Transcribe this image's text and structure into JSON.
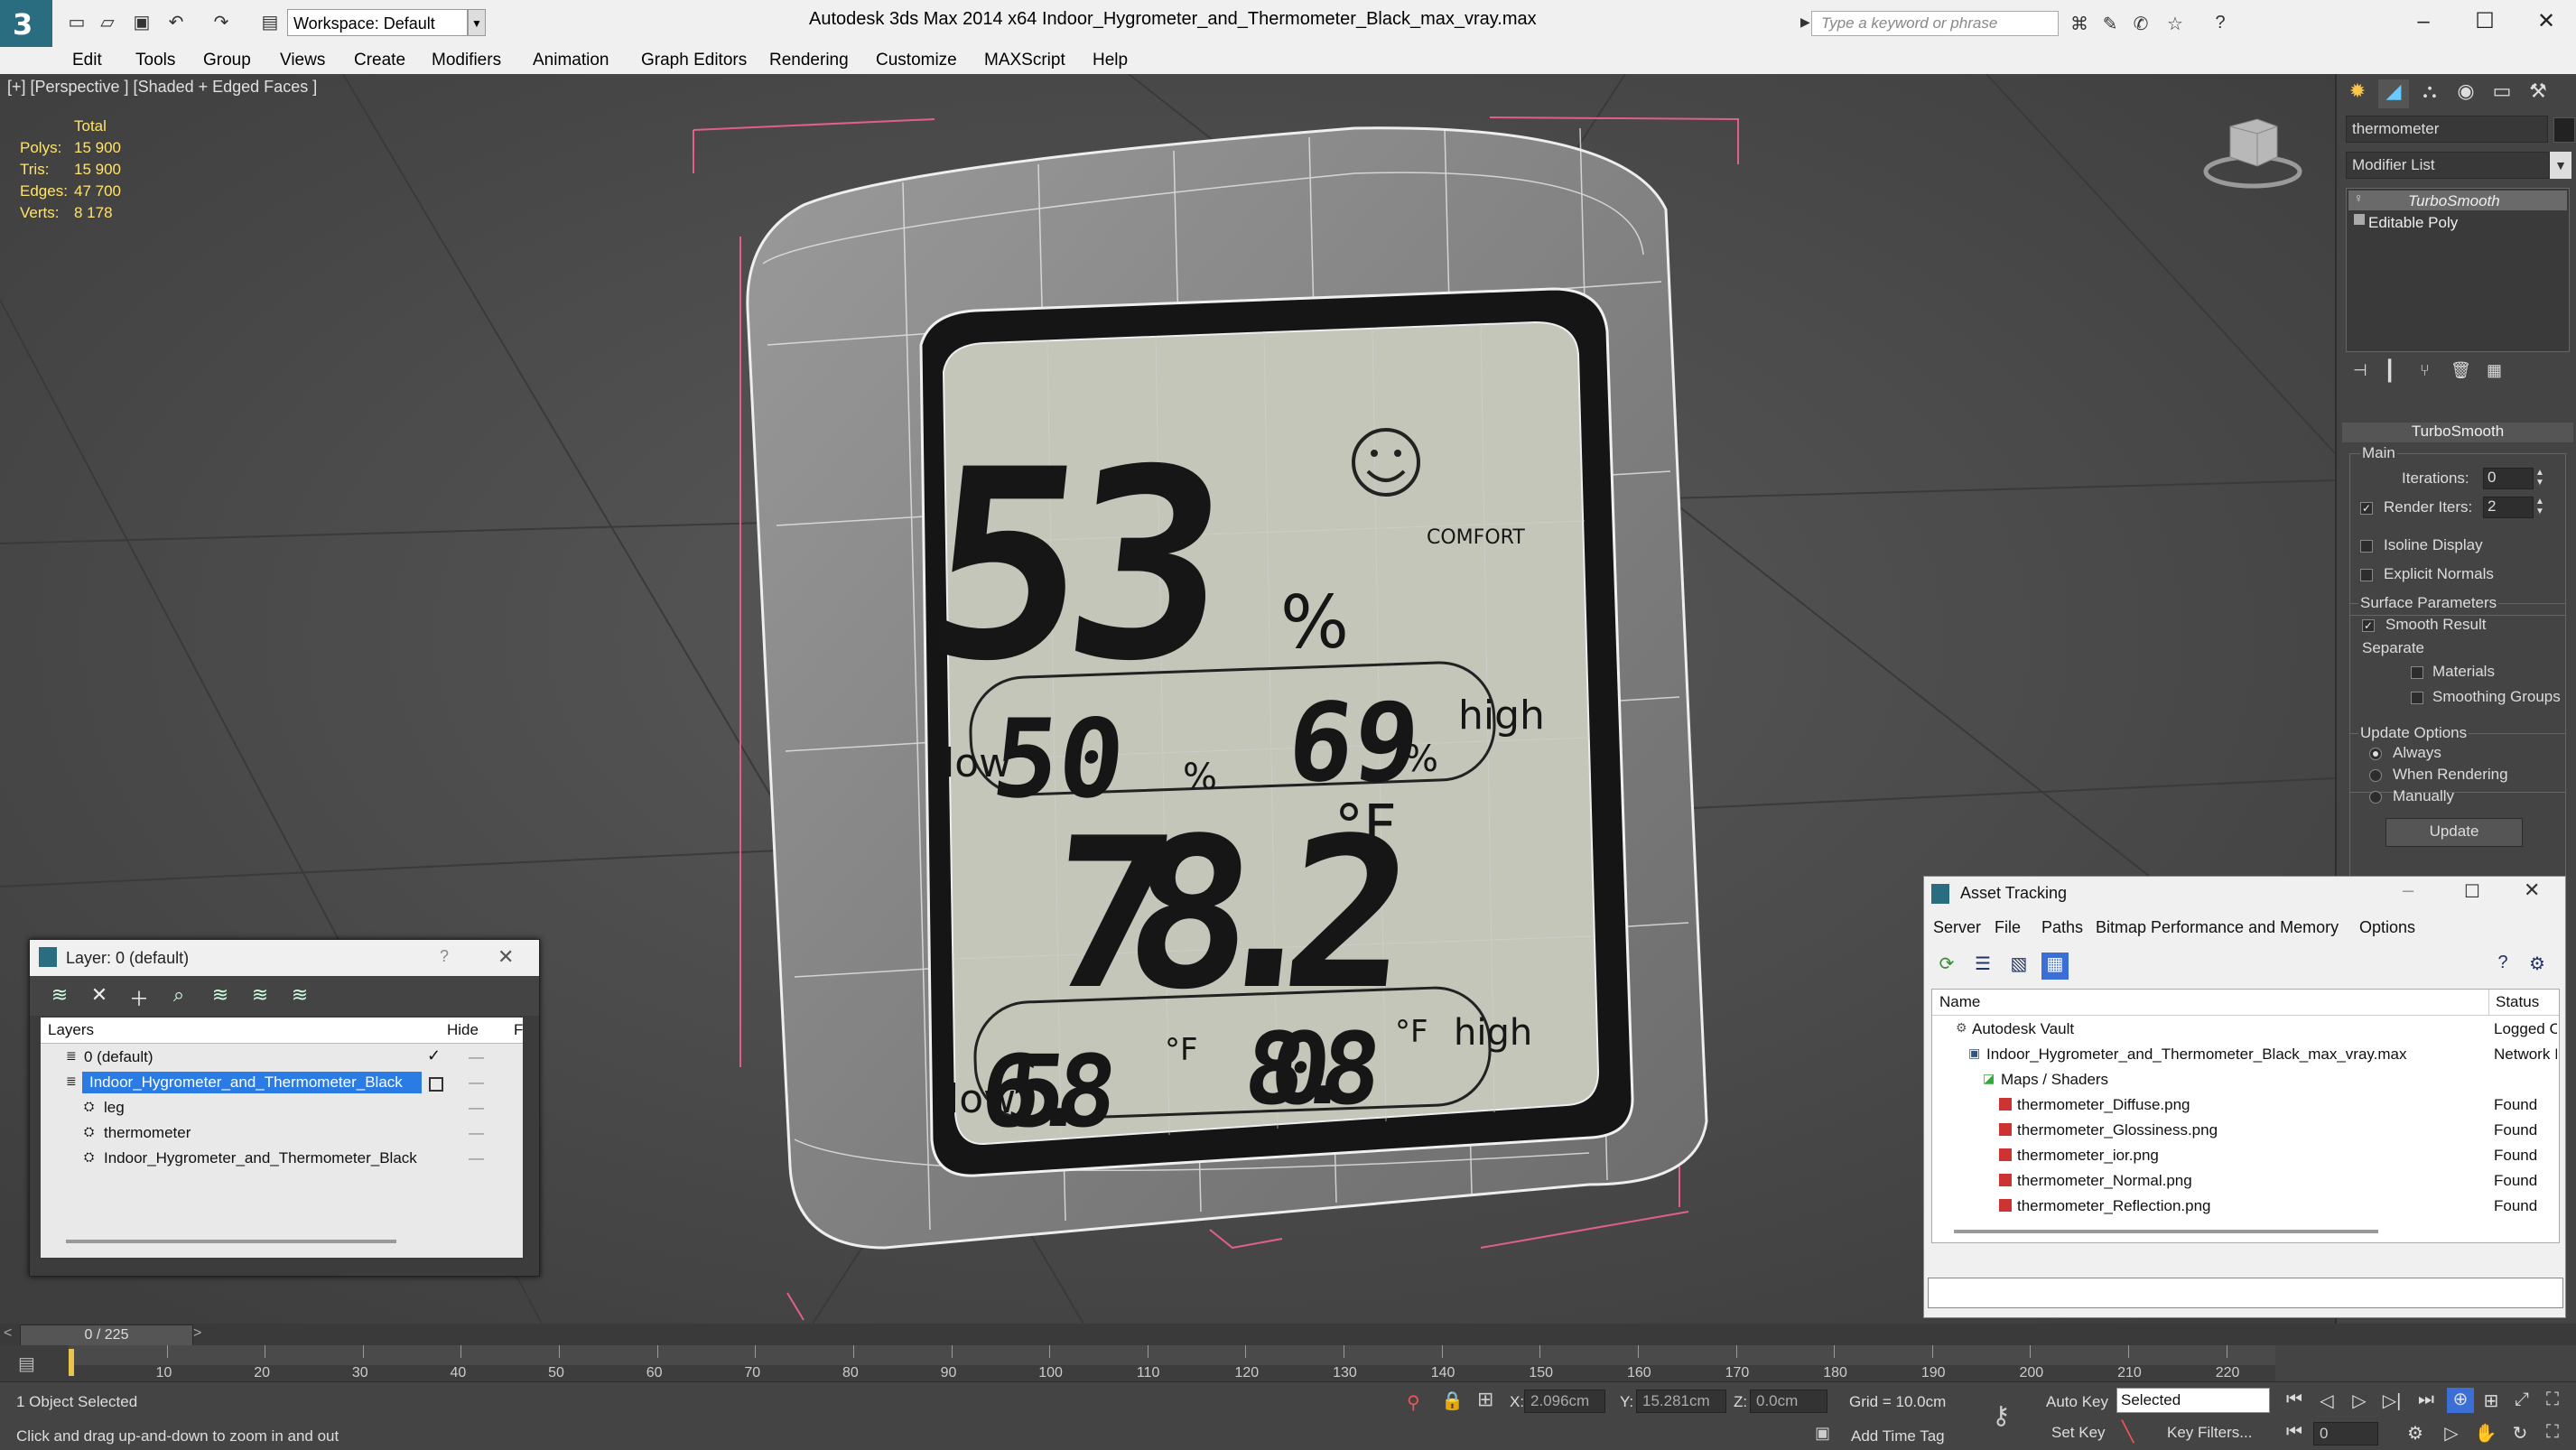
{
  "titlebar": {
    "workspace": "Workspace: Default",
    "app_title": "Autodesk 3ds Max  2014 x64",
    "document_title": "Indoor_Hygrometer_and_Thermometer_Black_max_vray.max",
    "search_placeholder": "Type a keyword or phrase"
  },
  "menu": {
    "items": [
      "Edit",
      "Tools",
      "Group",
      "Views",
      "Create",
      "Modifiers",
      "Animation",
      "Graph Editors",
      "Rendering",
      "Customize",
      "MAXScript",
      "Help"
    ]
  },
  "viewport": {
    "label": "[+] [Perspective ] [Shaded + Edged Faces ]",
    "stats": {
      "header": "Total",
      "rows": [
        {
          "label": "Polys:",
          "value": "15 900"
        },
        {
          "label": "Tris:",
          "value": "15 900"
        },
        {
          "label": "Edges:",
          "value": "47 700"
        },
        {
          "label": "Verts:",
          "value": "8 178"
        }
      ]
    },
    "display": {
      "big_humidity": "53",
      "pct": "%",
      "comfort": "COMFORT",
      "low_label": "low",
      "low_humidity": "50",
      "high_humidity": "69",
      "pct_small": "%",
      "high_label": "high",
      "temperature": "78.2",
      "degF": "°F",
      "low_temp": "65.8",
      "high_temp": "80.8",
      "low_label2": "low",
      "high_label2": "high",
      "degF_small": "°F"
    }
  },
  "command_panel": {
    "object_name": "thermometer",
    "modifier_list": "Modifier List",
    "stack": [
      "TurboSmooth",
      "Editable Poly"
    ],
    "rollout_title": "TurboSmooth",
    "main_group": "Main",
    "iterations_label": "Iterations:",
    "iterations_value": "0",
    "render_iters_label": "Render Iters:",
    "render_iters_value": "2",
    "render_iters_checked": true,
    "isoline_label": "Isoline Display",
    "explicit_normals_label": "Explicit Normals",
    "surface_group": "Surface Parameters",
    "smooth_result_label": "Smooth Result",
    "smooth_result_checked": true,
    "separate_label": "Separate",
    "materials_label": "Materials",
    "smoothing_groups_label": "Smoothing Groups",
    "update_group": "Update Options",
    "always_label": "Always",
    "when_rendering_label": "When Rendering",
    "manually_label": "Manually",
    "update_button": "Update"
  },
  "layer_window": {
    "title": "Layer: 0 (default)",
    "help": "?",
    "col_layers": "Layers",
    "col_hide": "Hide",
    "col_f": "F",
    "rows": [
      {
        "name": "0 (default)",
        "indent": 0,
        "selected": false
      },
      {
        "name": "Indoor_Hygrometer_and_Thermometer_Black",
        "indent": 0,
        "selected": true
      },
      {
        "name": "leg",
        "indent": 1,
        "selected": false
      },
      {
        "name": "thermometer",
        "indent": 1,
        "selected": false
      },
      {
        "name": "Indoor_Hygrometer_and_Thermometer_Black",
        "indent": 1,
        "selected": false
      }
    ]
  },
  "asset_window": {
    "title": "Asset Tracking",
    "menu": [
      "Server",
      "File",
      "Paths",
      "Bitmap Performance and Memory",
      "Options"
    ],
    "col_name": "Name",
    "col_status": "Status",
    "rows": [
      {
        "name": "Autodesk Vault",
        "status": "Logged C",
        "indent": 1
      },
      {
        "name": "Indoor_Hygrometer_and_Thermometer_Black_max_vray.max",
        "status": "Network I",
        "indent": 2
      },
      {
        "name": "Maps / Shaders",
        "status": "",
        "indent": 3
      },
      {
        "name": "thermometer_Diffuse.png",
        "status": "Found",
        "indent": 4
      },
      {
        "name": "thermometer_Glossiness.png",
        "status": "Found",
        "indent": 4
      },
      {
        "name": "thermometer_ior.png",
        "status": "Found",
        "indent": 4
      },
      {
        "name": "thermometer_Normal.png",
        "status": "Found",
        "indent": 4
      },
      {
        "name": "thermometer_Reflection.png",
        "status": "Found",
        "indent": 4
      }
    ]
  },
  "timeline": {
    "frame_counter": "0 / 225",
    "ticks": [
      "10",
      "20",
      "30",
      "40",
      "50",
      "60",
      "70",
      "80",
      "90",
      "100",
      "110",
      "120",
      "130",
      "140",
      "150",
      "160",
      "170",
      "180",
      "190",
      "200",
      "210",
      "220"
    ]
  },
  "status": {
    "selection": "1 Object Selected",
    "prompt": "Click and drag up-and-down to zoom in and out",
    "x_label": "X:",
    "x_value": "2.096cm",
    "y_label": "Y:",
    "y_value": "15.281cm",
    "z_label": "Z:",
    "z_value": "0.0cm",
    "grid": "Grid = 10.0cm",
    "add_time_tag": "Add Time Tag",
    "auto_key": "Auto Key",
    "selected": "Selected",
    "set_key": "Set Key",
    "key_filters": "Key Filters...",
    "frame": "0"
  }
}
